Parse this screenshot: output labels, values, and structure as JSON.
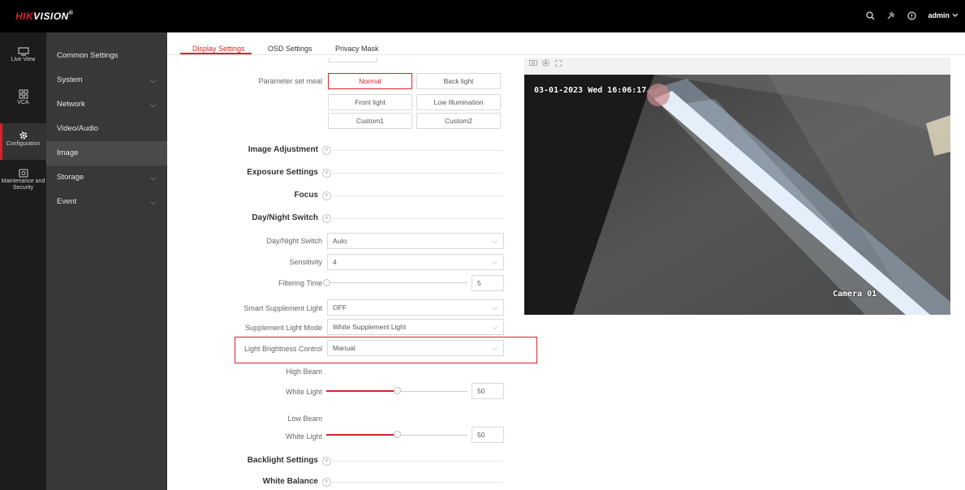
{
  "brand": {
    "logo_red": "HIK",
    "logo_white": "VISION",
    "logo_mark": "®"
  },
  "topbar": {
    "user": "admin",
    "icons": [
      "search-icon",
      "connector-icon",
      "help-icon"
    ]
  },
  "rail": [
    {
      "label": "Live View",
      "icon": "monitor-icon",
      "active": false
    },
    {
      "label": "VCA",
      "icon": "vca-icon",
      "active": false
    },
    {
      "label": "Configuration",
      "icon": "gear-icon",
      "active": true
    },
    {
      "label": "Maintenance and Security",
      "icon": "maintenance-icon",
      "active": false
    }
  ],
  "submenu": [
    {
      "label": "Common Settings",
      "expandable": false,
      "active": false
    },
    {
      "label": "System",
      "expandable": true,
      "active": false
    },
    {
      "label": "Network",
      "expandable": true,
      "active": false
    },
    {
      "label": "Video/Audio",
      "expandable": false,
      "active": false
    },
    {
      "label": "Image",
      "expandable": false,
      "active": true
    },
    {
      "label": "Storage",
      "expandable": true,
      "active": false
    },
    {
      "label": "Event",
      "expandable": true,
      "active": false
    }
  ],
  "tabs": [
    {
      "label": "Display Settings",
      "active": true
    },
    {
      "label": "OSD Settings",
      "active": false
    },
    {
      "label": "Privacy Mask",
      "active": false
    }
  ],
  "form": {
    "param_label": "Parameter set meal",
    "param_options": [
      "Normal",
      "Back light",
      "Front light",
      "Low Illumination",
      "Custom1",
      "Custom2"
    ],
    "param_selected": "Normal",
    "sections": {
      "image_adjustment": "Image Adjustment",
      "exposure": "Exposure Settings",
      "focus": "Focus",
      "day_night": "Day/Night Switch",
      "backlight": "Backlight Settings",
      "white_balance": "White Balance"
    },
    "day_night_switch": {
      "label": "Day/Night Switch",
      "value": "Auto"
    },
    "sensitivity": {
      "label": "Sensitivity",
      "value": "4"
    },
    "filtering_time": {
      "label": "Filtering Time",
      "value": "5"
    },
    "smart_supplement": {
      "label": "Smart Supplement Light",
      "value": "OFF"
    },
    "supplement_mode": {
      "label": "Supplement Light Mode",
      "value": "White Supplement Light"
    },
    "brightness_control": {
      "label": "Light Brightness Control",
      "value": "Manual"
    },
    "high_beam": {
      "label": "High Beam",
      "white_label": "White Light",
      "value": "50",
      "level_percent": 50
    },
    "low_beam": {
      "label": "Low Beam",
      "white_label": "White Light",
      "value": "50",
      "level_percent": 50
    }
  },
  "preview": {
    "timestamp": "03-01-2023 Wed 16:06:17",
    "camera_name": "Camera 01"
  }
}
